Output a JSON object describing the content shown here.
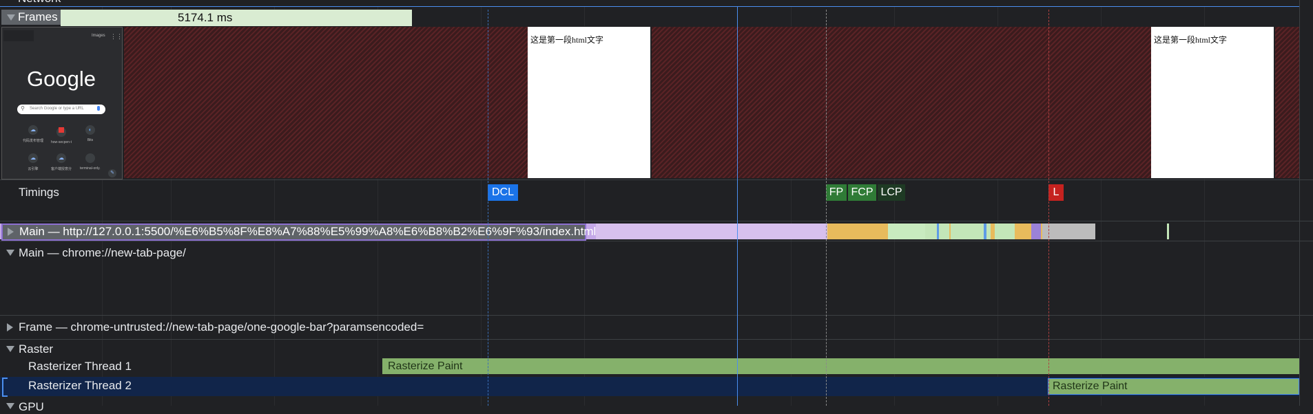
{
  "network": {
    "label": "Network"
  },
  "frames": {
    "label": "Frames",
    "duration": "5174.1 ms",
    "thumbnail_text_1": "这是第一段html文字",
    "thumbnail_text_2": "这是第一段html文字",
    "google_thumb": {
      "images_label": "Images",
      "logo": "Google",
      "search_placeholder": "Search Google or type a URL",
      "shortcuts": [
        "代码发布管理",
        "how-secpen-ty...",
        "Bits",
        "云引擎",
        "客户端授意分...",
        "terminal-only..."
      ]
    }
  },
  "timings": {
    "label": "Timings",
    "markers": {
      "dcl": "DCL",
      "fp": "FP",
      "fcp": "FCP",
      "lcp": "LCP",
      "l": "L"
    }
  },
  "main_tracks": {
    "main_index": "Main — http://127.0.0.1:5500/%E6%B5%8F%E8%A7%88%E5%99%A8%E6%B8%B2%E6%9F%93/index.html",
    "main_newtab": "Main — chrome://new-tab-page/",
    "frame_untrusted": "Frame — chrome-untrusted://new-tab-page/one-google-bar?paramsencoded="
  },
  "raster": {
    "label": "Raster",
    "thread1": "Rasterizer Thread 1",
    "thread2": "Rasterizer Thread 2",
    "task1": "Rasterize Paint",
    "task2": "Rasterize Paint"
  },
  "gpu": {
    "label": "GPU"
  },
  "colors": {
    "scripting": "#f1c453",
    "rendering": "#c4a8e8",
    "painting": "#7fb572",
    "system": "#bcbcbc",
    "loading": "#5e9be6",
    "selection": "#4b8ff0",
    "dcl_marker": "#1a73e8",
    "fp_marker": "#2f7b36",
    "fcp_marker": "#2f7b36",
    "lcp_marker": "#1e3a24",
    "l_marker": "#c5221f"
  }
}
